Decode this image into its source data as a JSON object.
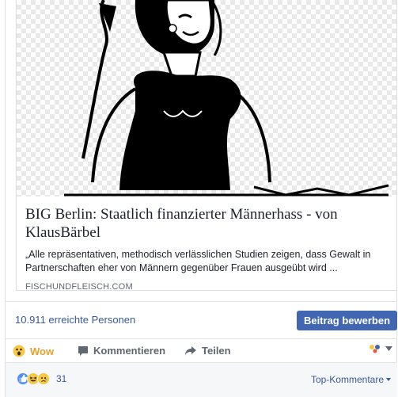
{
  "link_preview": {
    "title": "BIG Berlin: Staatlich finanzierter Männerhass - von KlausBärbel",
    "description": "„Alle repräsentativen, methodisch verlässlichen Studien zeigen, dass Gewalt in Partnerschaften eher von Männern gegenüber Frauen ausgeübt wird ...",
    "domain": "FISCHUNDFLEISCH.COM"
  },
  "reach": {
    "text": "10.911 erreichte Personen",
    "boost_label": "Beitrag bewerben"
  },
  "actions": {
    "wow_label": "Wow",
    "comment_label": "Kommentieren",
    "share_label": "Teilen"
  },
  "reactions": {
    "count": "31",
    "top_comments_label": "Top-Kommentare",
    "icons": [
      "like-icon",
      "haha-icon",
      "sad-icon"
    ]
  },
  "colors": {
    "link_blue": "#385898",
    "button_blue": "#4267b2",
    "wow_yellow": "#e8a02b",
    "muted_gray": "#606770"
  }
}
